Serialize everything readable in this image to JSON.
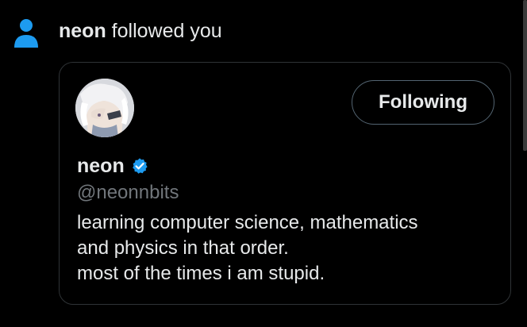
{
  "notification": {
    "icon": "person-icon",
    "actor_name": "neon",
    "action_text": " followed you",
    "icon_color": "#1d9bf0"
  },
  "profile_card": {
    "display_name": "neon",
    "verified": true,
    "verified_color": "#1d9bf0",
    "handle": "@neonnbits",
    "follow_button_label": "Following",
    "bio_lines": [
      "learning computer science, mathematics",
      "and physics in that order.",
      "most of the times i am stupid."
    ]
  }
}
